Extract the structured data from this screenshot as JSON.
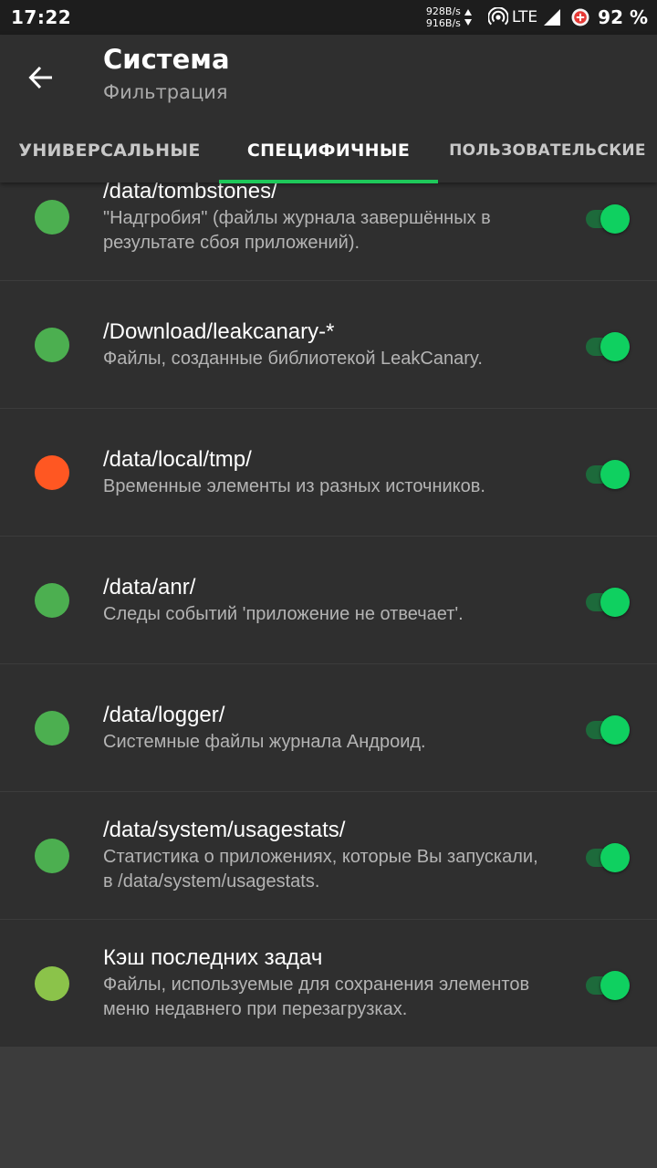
{
  "status_bar": {
    "time": "17:22",
    "net_up": "928B/s",
    "net_down": "916B/s",
    "network": "LTE",
    "battery": "92 %"
  },
  "header": {
    "title": "Система",
    "subtitle": "Фильтрация"
  },
  "tabs": [
    {
      "label": "УНИВЕРСАЛЬНЫЕ",
      "active": false
    },
    {
      "label": "СПЕЦИФИЧНЫЕ",
      "active": true
    },
    {
      "label": "ПОЛЬЗОВАТЕЛЬСКИЕ",
      "active": false
    }
  ],
  "colors": {
    "accent": "#1ec85a",
    "dot_green": "#4caf50",
    "dot_orange": "#ff5722",
    "dot_lightgreen": "#8bc34a",
    "toggle_on": "#0fd060"
  },
  "items": [
    {
      "path": "/data/tombstones/",
      "description": "\"Надгробия\" (файлы журнала завершённых в результате сбоя приложений).",
      "dot_color": "#4caf50",
      "enabled": true
    },
    {
      "path": "/Download/leakcanary-*",
      "description": "Файлы, созданные библиотекой LeakCanary.",
      "dot_color": "#4caf50",
      "enabled": true
    },
    {
      "path": "/data/local/tmp/",
      "description": "Временные элементы из разных источников.",
      "dot_color": "#ff5722",
      "enabled": true
    },
    {
      "path": "/data/anr/",
      "description": "Следы событий 'приложение не отвечает'.",
      "dot_color": "#4caf50",
      "enabled": true
    },
    {
      "path": "/data/logger/",
      "description": "Системные файлы журнала Андроид.",
      "dot_color": "#4caf50",
      "enabled": true
    },
    {
      "path": "/data/system/usagestats/",
      "description": "Статистика о приложениях, которые Вы запускали, в /data/system/usagestats.",
      "dot_color": "#4caf50",
      "enabled": true
    },
    {
      "path": "Кэш последних задач",
      "description": "Файлы, используемые для сохранения элементов меню недавнего при перезагрузках.",
      "dot_color": "#8bc34a",
      "enabled": true
    }
  ]
}
